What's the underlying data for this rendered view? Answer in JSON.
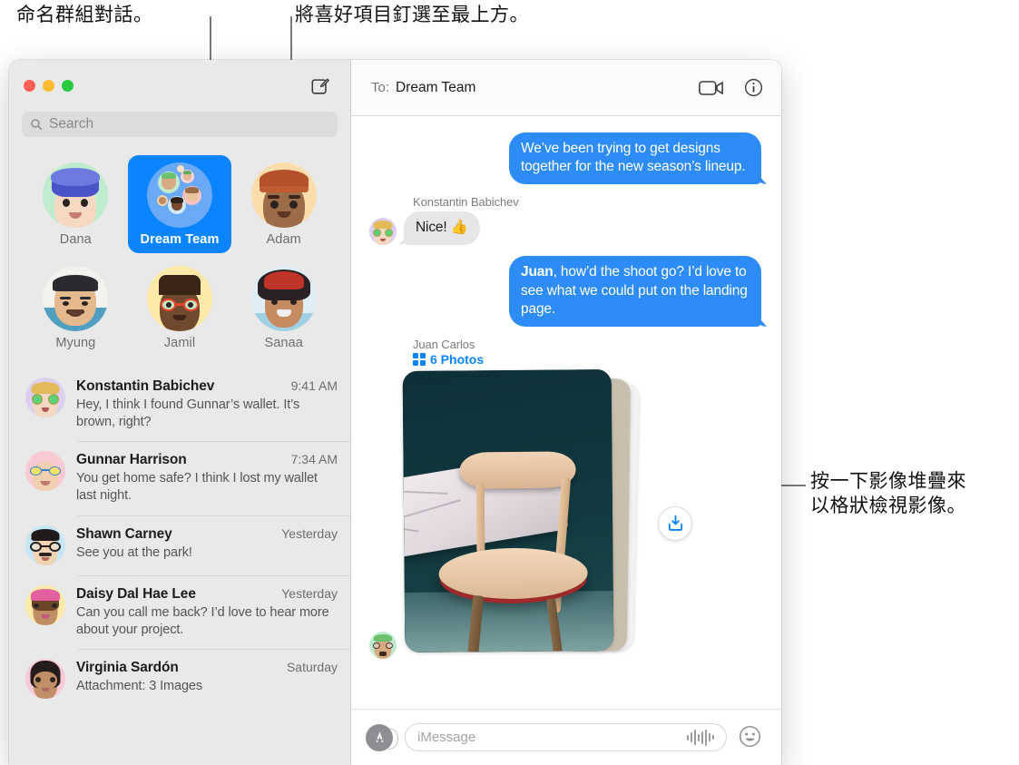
{
  "annotations": {
    "top_left": "命名群組對話。",
    "top_right": "將喜好項目釘選至最上方。",
    "right": "按一下影像堆疊來\n以格狀檢視影像。"
  },
  "window": {
    "traffic_lights": [
      "close",
      "minimize",
      "zoom"
    ],
    "compose_label": "compose"
  },
  "sidebar": {
    "search": {
      "placeholder": "Search"
    },
    "pinned": [
      {
        "name": "Dana",
        "selected": false
      },
      {
        "name": "Dream Team",
        "selected": true
      },
      {
        "name": "Adam",
        "selected": false
      },
      {
        "name": "Myung",
        "selected": false
      },
      {
        "name": "Jamil",
        "selected": false
      },
      {
        "name": "Sanaa",
        "selected": false
      }
    ],
    "conversations": [
      {
        "name": "Konstantin Babichev",
        "time": "9:41 AM",
        "preview": "Hey, I think I found Gunnar’s wallet. It’s brown, right?"
      },
      {
        "name": "Gunnar Harrison",
        "time": "7:34 AM",
        "preview": "You get home safe? I think I lost my wallet last night."
      },
      {
        "name": "Shawn Carney",
        "time": "Yesterday",
        "preview": "See you at the park!"
      },
      {
        "name": "Daisy Dal Hae Lee",
        "time": "Yesterday",
        "preview": "Can you call me back? I’d love to hear more about your project."
      },
      {
        "name": "Virginia Sardón",
        "time": "Saturday",
        "preview": "Attachment: 3 Images"
      }
    ]
  },
  "conversation": {
    "to_label": "To:",
    "to_value": "Dream Team",
    "facetime_icon": "video-camera-icon",
    "info_icon": "info-circle-icon",
    "messages": [
      {
        "side": "outgoing",
        "text": "We’ve been trying to get designs together for the new season’s lineup."
      },
      {
        "side": "incoming",
        "sender": "Konstantin Babichev",
        "text": "Nice!  👍"
      },
      {
        "side": "outgoing",
        "mention": "Juan",
        "text": ", how’d the shoot go? I’d love to see what we could put on the landing page."
      },
      {
        "side": "incoming",
        "sender": "Juan Carlos",
        "attachment_count": "6 Photos",
        "attachment_type": "photo-stack",
        "download_icon": "download-icon"
      }
    ]
  },
  "composer": {
    "appstore_icon": "app-store-icon",
    "placeholder": "iMessage",
    "audio_icon": "audio-waveform-icon",
    "emoji_icon": "emoji-smiley-icon"
  },
  "colors": {
    "accent_blue": "#0a84ff",
    "bubble_blue": "#2d8cf8",
    "bubble_gray": "#e6e6e8",
    "sidebar_bg": "#e9e9e9"
  }
}
